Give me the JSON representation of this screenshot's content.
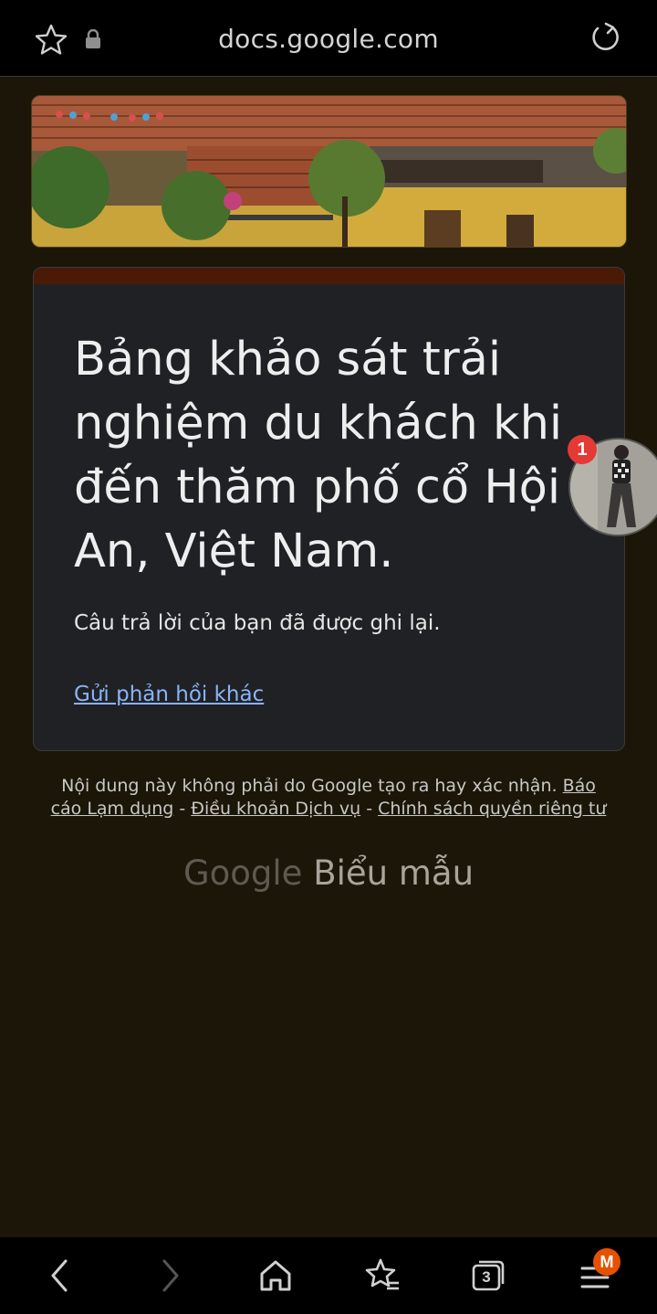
{
  "browser": {
    "url": "docs.google.com",
    "tab_count": "3",
    "menu_badge": "M"
  },
  "form": {
    "title": "Bảng khảo sát trải nghiệm du khách khi đến thăm phố cổ Hội An, Việt Nam.",
    "confirmation": "Câu trả lời của bạn đã được ghi lại.",
    "submit_another": "Gửi phản hồi khác"
  },
  "footer": {
    "disclaimer": "Nội dung này không phải do Google tạo ra hay xác nhận.",
    "report_abuse": "Báo cáo Lạm dụng",
    "terms": "Điều khoản Dịch vụ",
    "privacy": "Chính sách quyền riêng tư",
    "separator": " - ",
    "brand_google": "Google",
    "brand_forms": "Biểu mẫu"
  },
  "chat_head": {
    "badge": "1"
  },
  "icons": {
    "bookmark": "star-outline-icon",
    "lock": "lock-icon",
    "reload": "reload-icon",
    "back": "chevron-left-icon",
    "forward": "chevron-right-icon",
    "home": "home-icon",
    "bookmarks": "star-list-icon",
    "tabs": "tabs-icon",
    "menu": "menu-icon"
  },
  "colors": {
    "page_bg": "#1b1607",
    "card_bg": "#202124",
    "accent": "#4a1a06",
    "link": "#8ab4f8"
  }
}
